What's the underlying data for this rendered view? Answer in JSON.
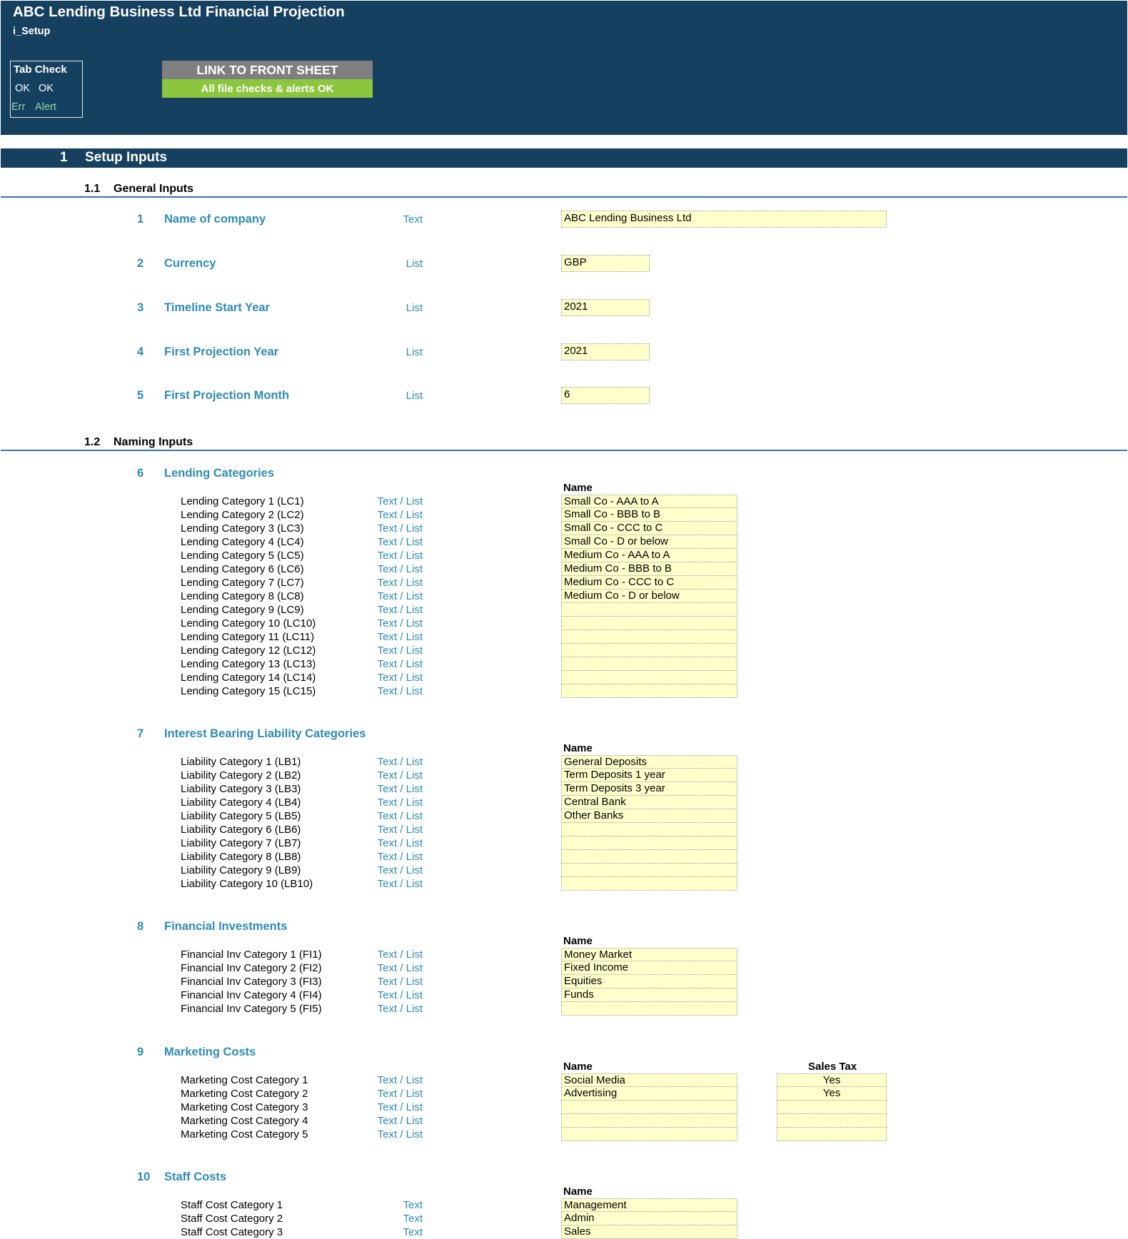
{
  "header": {
    "title": "ABC Lending Business Ltd Financial Projection",
    "sheet_name": "i_Setup",
    "tab_check": {
      "title": "Tab Check",
      "ok1": "OK",
      "ok2": "OK",
      "err": "Err",
      "alert": "Alert"
    },
    "link_button": "LINK TO FRONT SHEET",
    "check_banner": "All file checks & alerts OK"
  },
  "section": {
    "number": "1",
    "title": "Setup Inputs"
  },
  "general": {
    "number": "1.1",
    "title": "General Inputs",
    "items": [
      {
        "num": "1",
        "label": "Name of company",
        "type": "Text",
        "value": "ABC Lending Business Ltd"
      },
      {
        "num": "2",
        "label": "Currency",
        "type": "List",
        "value": "GBP"
      },
      {
        "num": "3",
        "label": "Timeline Start Year",
        "type": "List",
        "value": "2021"
      },
      {
        "num": "4",
        "label": "First Projection Year",
        "type": "List",
        "value": "2021"
      },
      {
        "num": "5",
        "label": "First Projection Month",
        "type": "List",
        "value": "6"
      }
    ]
  },
  "naming": {
    "number": "1.2",
    "title": "Naming Inputs",
    "name_header": "Name",
    "sales_tax_header": "Sales Tax",
    "groups": [
      {
        "num": "6",
        "title": "Lending Categories",
        "rows": [
          {
            "label": "Lending Category 1 (LC1)",
            "type": "Text / List",
            "value": "Small Co - AAA to A"
          },
          {
            "label": "Lending Category 2 (LC2)",
            "type": "Text / List",
            "value": "Small Co - BBB to B"
          },
          {
            "label": "Lending Category 3 (LC3)",
            "type": "Text / List",
            "value": "Small Co - CCC to C"
          },
          {
            "label": "Lending Category 4 (LC4)",
            "type": "Text / List",
            "value": "Small Co - D or below"
          },
          {
            "label": "Lending Category 5 (LC5)",
            "type": "Text / List",
            "value": "Medium Co - AAA to A"
          },
          {
            "label": "Lending Category 6 (LC6)",
            "type": "Text / List",
            "value": "Medium Co - BBB to B"
          },
          {
            "label": "Lending Category 7 (LC7)",
            "type": "Text / List",
            "value": "Medium Co - CCC to C"
          },
          {
            "label": "Lending Category 8 (LC8)",
            "type": "Text / List",
            "value": "Medium Co - D or below"
          },
          {
            "label": "Lending Category 9 (LC9)",
            "type": "Text / List",
            "value": ""
          },
          {
            "label": "Lending Category 10 (LC10)",
            "type": "Text / List",
            "value": ""
          },
          {
            "label": "Lending Category 11 (LC11)",
            "type": "Text / List",
            "value": ""
          },
          {
            "label": "Lending Category 12 (LC12)",
            "type": "Text / List",
            "value": ""
          },
          {
            "label": "Lending Category 13 (LC13)",
            "type": "Text / List",
            "value": ""
          },
          {
            "label": "Lending Category 14 (LC14)",
            "type": "Text / List",
            "value": ""
          },
          {
            "label": "Lending Category 15 (LC15)",
            "type": "Text / List",
            "value": ""
          }
        ]
      },
      {
        "num": "7",
        "title": "Interest Bearing Liability Categories",
        "rows": [
          {
            "label": "Liability Category 1 (LB1)",
            "type": "Text / List",
            "value": "General Deposits"
          },
          {
            "label": "Liability Category 2 (LB2)",
            "type": "Text / List",
            "value": "Term Deposits 1 year"
          },
          {
            "label": "Liability Category 3 (LB3)",
            "type": "Text / List",
            "value": "Term Deposits 3 year"
          },
          {
            "label": "Liability Category 4 (LB4)",
            "type": "Text / List",
            "value": "Central Bank"
          },
          {
            "label": "Liability Category 5 (LB5)",
            "type": "Text / List",
            "value": "Other Banks"
          },
          {
            "label": "Liability Category 6 (LB6)",
            "type": "Text / List",
            "value": ""
          },
          {
            "label": "Liability Category 7 (LB7)",
            "type": "Text / List",
            "value": ""
          },
          {
            "label": "Liability Category 8 (LB8)",
            "type": "Text / List",
            "value": ""
          },
          {
            "label": "Liability Category 9 (LB9)",
            "type": "Text / List",
            "value": ""
          },
          {
            "label": "Liability Category 10 (LB10)",
            "type": "Text / List",
            "value": ""
          }
        ]
      },
      {
        "num": "8",
        "title": "Financial Investments",
        "rows": [
          {
            "label": "Financial Inv Category 1 (FI1)",
            "type": "Text / List",
            "value": "Money Market"
          },
          {
            "label": "Financial Inv Category 2 (FI2)",
            "type": "Text / List",
            "value": "Fixed Income"
          },
          {
            "label": "Financial Inv Category 3 (FI3)",
            "type": "Text / List",
            "value": "Equities"
          },
          {
            "label": "Financial Inv Category 4 (FI4)",
            "type": "Text / List",
            "value": "Funds"
          },
          {
            "label": "Financial Inv Category 5 (FI5)",
            "type": "Text / List",
            "value": ""
          }
        ]
      },
      {
        "num": "9",
        "title": "Marketing Costs",
        "has_sales_tax": true,
        "rows": [
          {
            "label": "Marketing Cost Category 1",
            "type": "Text / List",
            "value": "Social Media",
            "sales_tax": "Yes"
          },
          {
            "label": "Marketing Cost Category 2",
            "type": "Text / List",
            "value": "Advertising",
            "sales_tax": "Yes"
          },
          {
            "label": "Marketing Cost Category 3",
            "type": "Text / List",
            "value": "",
            "sales_tax": ""
          },
          {
            "label": "Marketing Cost Category 4",
            "type": "Text / List",
            "value": "",
            "sales_tax": ""
          },
          {
            "label": "Marketing Cost Category 5",
            "type": "Text / List",
            "value": "",
            "sales_tax": ""
          }
        ]
      },
      {
        "num": "10",
        "title": "Staff Costs",
        "rows": [
          {
            "label": "Staff Cost Category 1",
            "type": "Text",
            "value": "Management"
          },
          {
            "label": "Staff Cost Category 2",
            "type": "Text",
            "value": "Admin"
          },
          {
            "label": "Staff Cost Category 3",
            "type": "Text",
            "value": "Sales"
          }
        ]
      }
    ]
  },
  "colors": {
    "header_bg": "#16405f",
    "accent_blue": "#2e8bb5",
    "input_fill": "#ffffcc",
    "link_grey": "#7f7f7f",
    "check_green": "#8cc63e"
  }
}
